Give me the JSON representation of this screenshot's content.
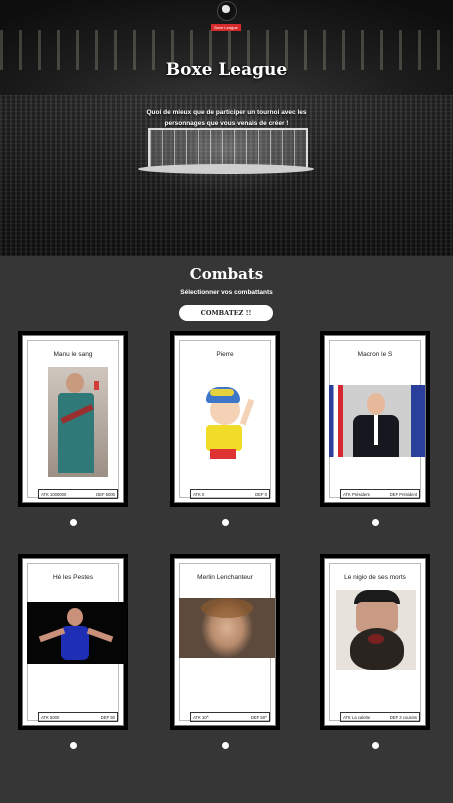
{
  "hero": {
    "logo_tag": "Boxe League",
    "title": "Boxe League",
    "subtitle": "Quoi de mieux que de participer un tournoi avec les personnages que vous venais de créer !"
  },
  "section": {
    "title": "Combats",
    "subtitle": "Sélectionner vos combattants",
    "button_label": "COMBATEZ !!"
  },
  "fighters": [
    {
      "name": "Manu le sang",
      "atk": "ATK 1000000",
      "def": "DEF 5000",
      "image": "man-holding-guitar-selfie-photo"
    },
    {
      "name": "Pierre",
      "atk": "ATK 0",
      "def": "DEF 0",
      "image": "cartoon-boy-yellow-cap-waving"
    },
    {
      "name": "Macron le S",
      "atk": "ATK Président",
      "def": "DEF Président",
      "image": "man-in-suit-with-flags"
    },
    {
      "name": "Hé les Pestes",
      "atk": "ATK 5000",
      "def": "DEF 50",
      "image": "wrestler-in-singlet"
    },
    {
      "name": "Merlin Lenchanteur",
      "atk": "ATK 10^",
      "def": "DEF 50^",
      "image": "man-close-up-face"
    },
    {
      "name": "Le nigio de ses morts",
      "atk": "ATK La calotte",
      "def": "DEF 3 cousins",
      "image": "bearded-man-shouting-cap"
    }
  ]
}
